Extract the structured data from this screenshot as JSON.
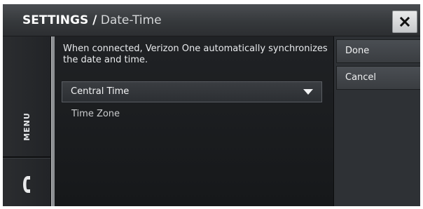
{
  "header": {
    "title_main": "SETTINGS /",
    "title_sub": "Date-Time",
    "close_icon": "close-x-icon"
  },
  "left_rail": {
    "menu_label": "MENU",
    "phone_icon": "phone-handset-icon"
  },
  "content": {
    "info_text": "When connected, Verizon One automatically synchronizes the date and time.",
    "timezone_select": {
      "value": "Central Time",
      "arrow_icon": "chevron-down-icon"
    },
    "timezone_label": "Time Zone"
  },
  "actions": {
    "done_label": "Done",
    "cancel_label": "Cancel"
  },
  "colors": {
    "background": "#101214",
    "titlebar": "#36393c",
    "button": "#3f4247",
    "text": "#e9ebed"
  }
}
